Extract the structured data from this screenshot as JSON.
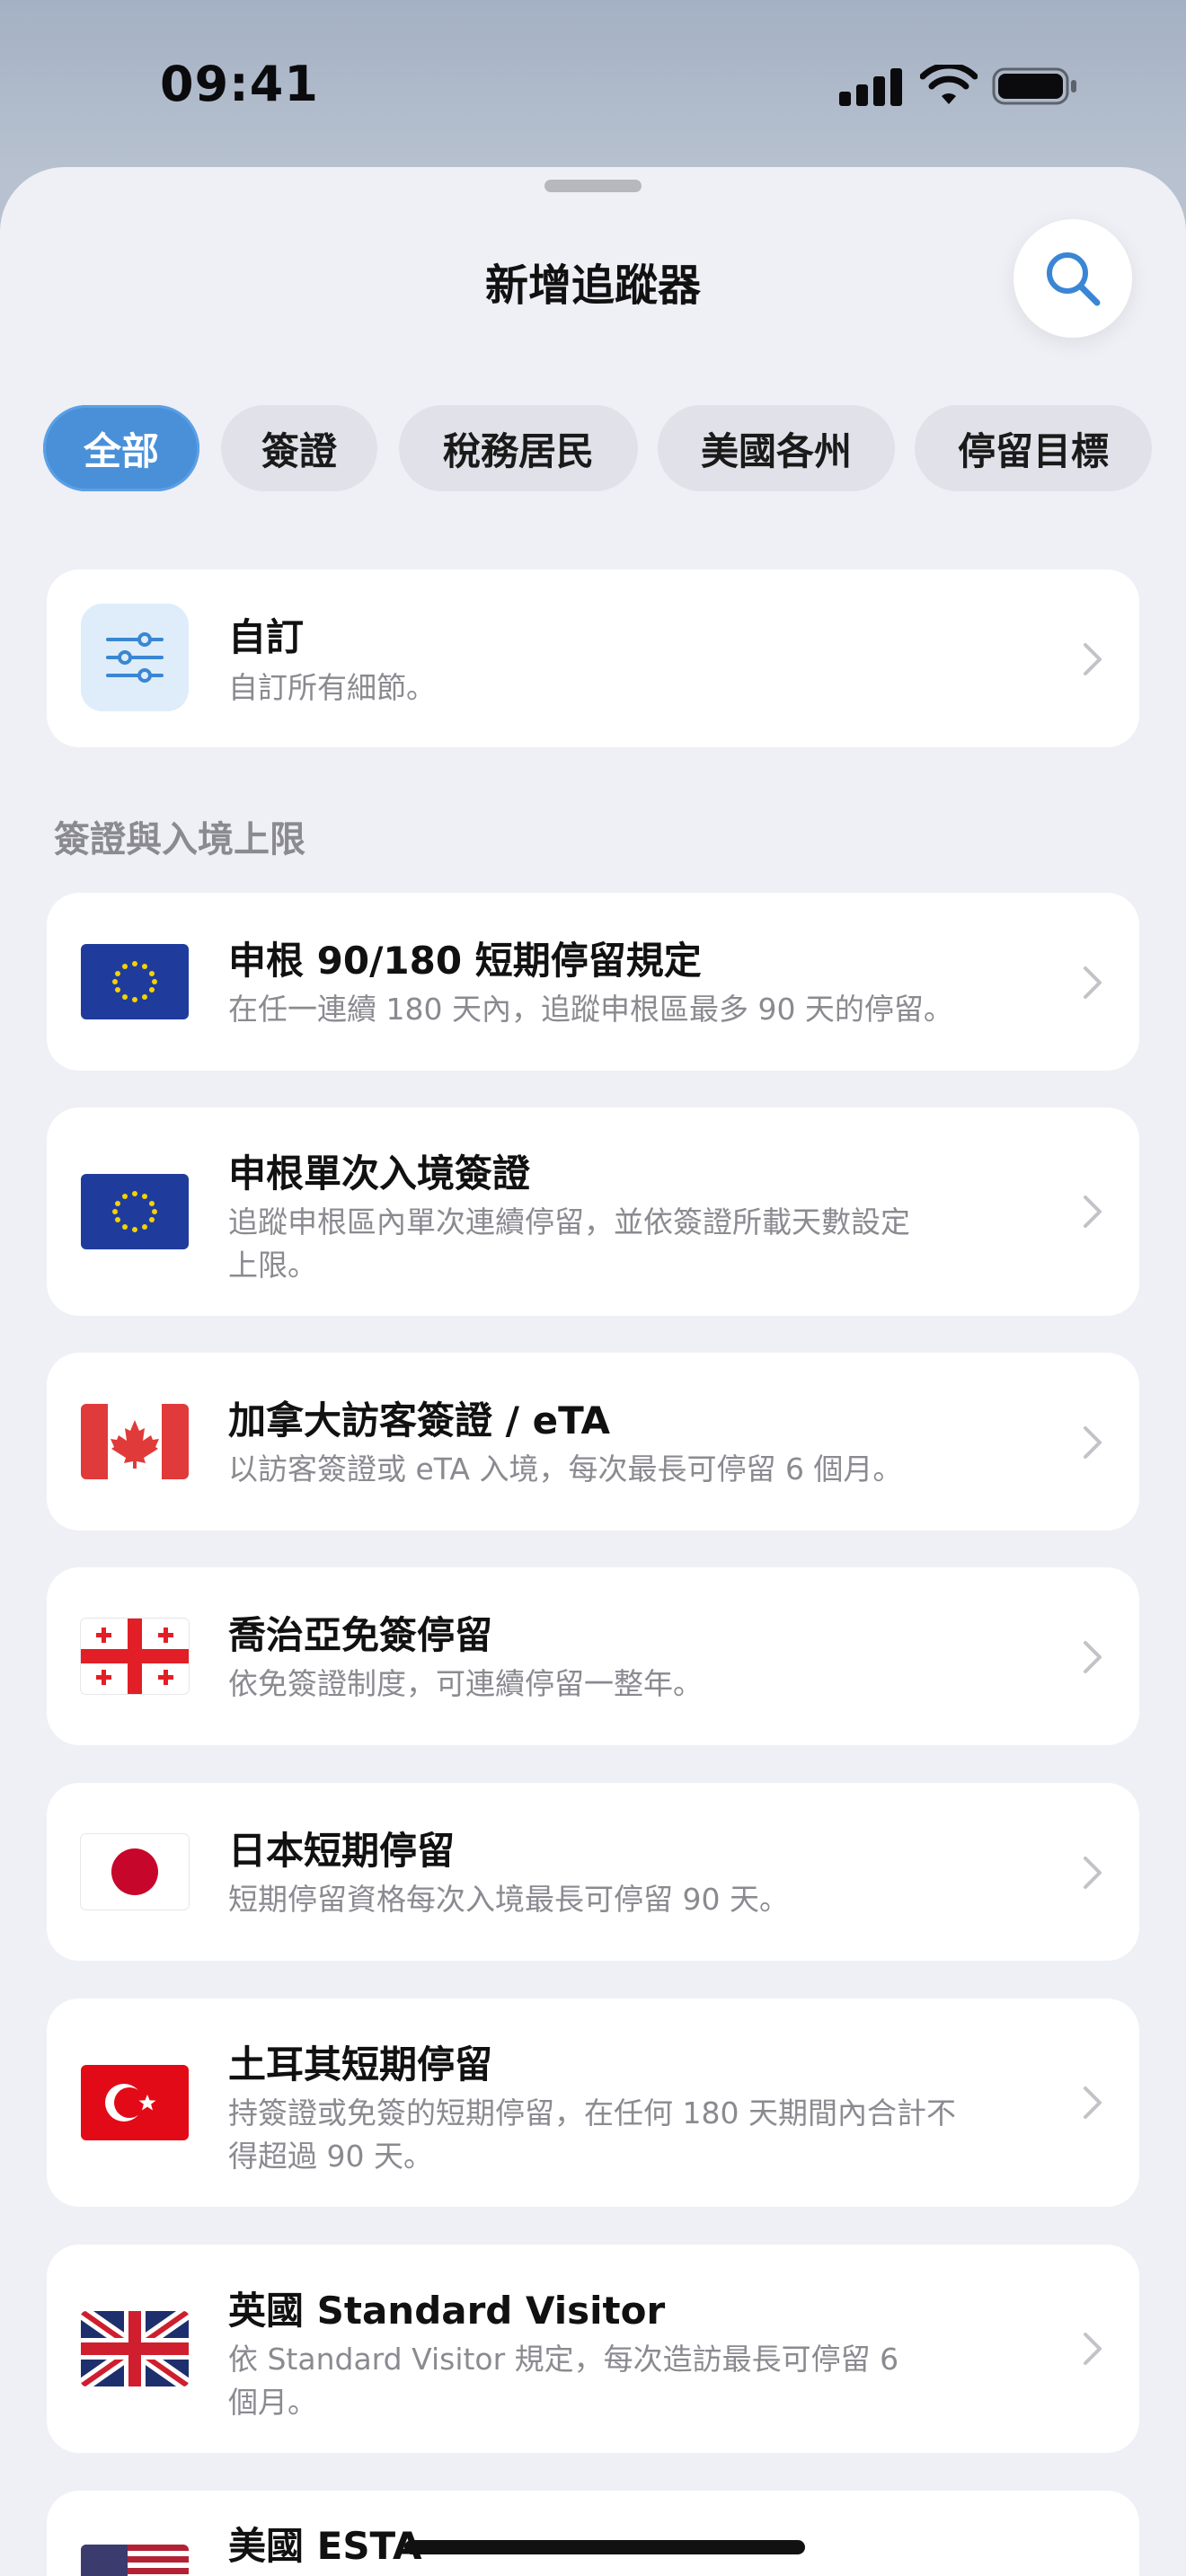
{
  "status": {
    "time": "09:41",
    "icons": [
      "cellular-signal-icon",
      "wifi-icon",
      "battery-icon"
    ]
  },
  "sheet": {
    "title": "新增追蹤器",
    "search_icon": "search-icon"
  },
  "chips": [
    {
      "label": "全部",
      "active": true
    },
    {
      "label": "簽證",
      "active": false
    },
    {
      "label": "稅務居民",
      "active": false
    },
    {
      "label": "美國各州",
      "active": false
    },
    {
      "label": "停留目標",
      "active": false
    }
  ],
  "custom": {
    "title": "自訂",
    "desc": "自訂所有細節。",
    "icon": "sliders-icon"
  },
  "section_header": "簽證與入境上限",
  "items": [
    {
      "title": "申根 90/180 短期停留規定",
      "desc": "在任一連續 180 天內，追蹤申根區最多 90 天的停留。",
      "flag": "eu-flag-icon"
    },
    {
      "title": "申根單次入境簽證",
      "desc": "追蹤申根區內單次連續停留，並依簽證所載天數設定上限。",
      "flag": "eu-flag-icon"
    },
    {
      "title": "加拿大訪客簽證 / eTA",
      "desc": "以訪客簽證或 eTA 入境，每次最長可停留 6 個月。",
      "flag": "canada-flag-icon"
    },
    {
      "title": "喬治亞免簽停留",
      "desc": "依免簽證制度，可連續停留一整年。",
      "flag": "georgia-flag-icon"
    },
    {
      "title": "日本短期停留",
      "desc": "短期停留資格每次入境最長可停留 90 天。",
      "flag": "japan-flag-icon"
    },
    {
      "title": "土耳其短期停留",
      "desc": "持簽證或免簽的短期停留，在任何 180 天期間內合計不得超過 90 天。",
      "flag": "turkey-flag-icon"
    },
    {
      "title": "英國 Standard Visitor",
      "desc": "依 Standard Visitor 規定，每次造訪最長可停留 6 個月。",
      "flag": "uk-flag-icon"
    },
    {
      "title": "美國 ESTA",
      "desc": "",
      "flag": "us-flag-icon"
    }
  ],
  "colors": {
    "accent": "#4a90d9",
    "sheet_bg": "#efeff6",
    "card_bg": "#ffffff",
    "secondary_text": "#8a8a90"
  }
}
